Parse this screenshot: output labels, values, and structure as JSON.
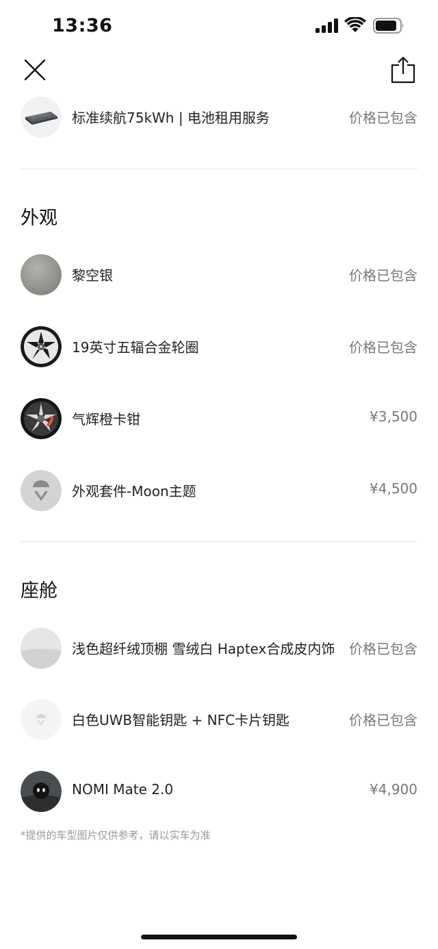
{
  "status_bar": {
    "time": "13:36"
  },
  "battery_item": {
    "label": "标准续航75kWh | 电池租用服务",
    "price": "价格已包含"
  },
  "exterior": {
    "title": "外观",
    "items": [
      {
        "label": "黎空银",
        "price": "价格已包含",
        "icon": "silver-paint-swatch"
      },
      {
        "label": "19英寸五辐合金轮圈",
        "price": "价格已包含",
        "icon": "wheel"
      },
      {
        "label": "气辉橙卡钳",
        "price": "¥3,500",
        "icon": "wheel-with-orange-caliper"
      },
      {
        "label": "外观套件-Moon主题",
        "price": "¥4,500",
        "icon": "nio-logo"
      }
    ]
  },
  "cabin": {
    "title": "座舱",
    "items": [
      {
        "label": "浅色超纤绒顶棚 雪绒白 Haptex合成皮内饰",
        "price": "价格已包含",
        "icon": "interior-swatch"
      },
      {
        "label": "白色UWB智能钥匙 + NFC卡片钥匙",
        "price": "价格已包含",
        "icon": "nio-key-logo"
      },
      {
        "label": "NOMI Mate 2.0",
        "price": "¥4,900",
        "icon": "nomi-robot"
      }
    ]
  },
  "footnote": "*提供的车型图片仅供参考，请以实车为准"
}
